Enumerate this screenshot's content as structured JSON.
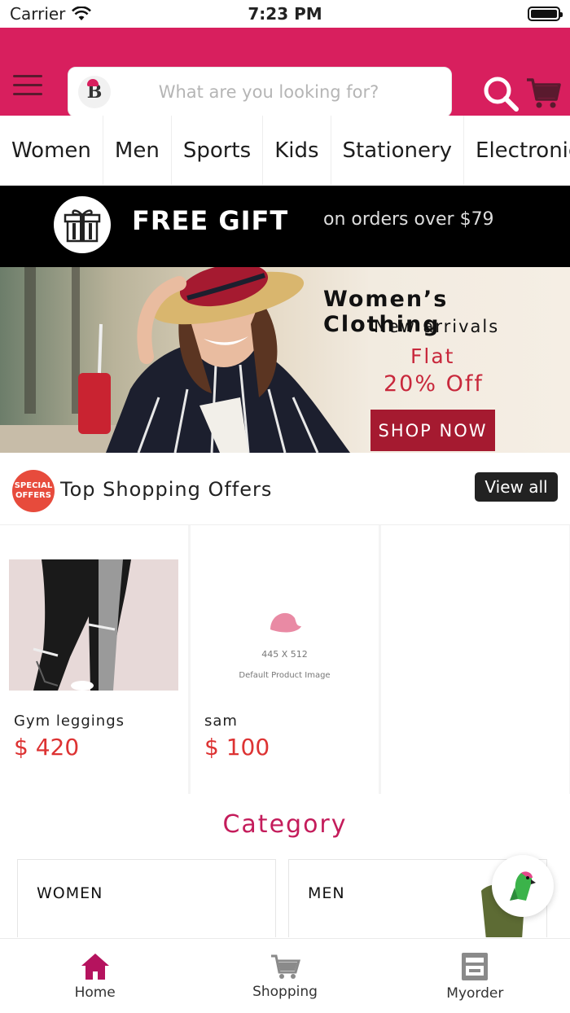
{
  "status_bar": {
    "carrier": "Carrier",
    "time": "7:23 PM"
  },
  "header": {
    "search_placeholder": "What are you looking for?",
    "logo_letter": "B",
    "brand_color": "#d81f5e"
  },
  "categories_strip": [
    "Women",
    "Men",
    "Sports",
    "Kids",
    "Stationery",
    "Electronics"
  ],
  "promo_bar": {
    "title": "FREE GIFT",
    "subtitle": "on orders over $79"
  },
  "banner": {
    "title": "Women’s Clothing",
    "subtitle": "New arrivals",
    "flat": "Flat",
    "discount": "20% Off",
    "cta": "SHOP NOW"
  },
  "offers": {
    "badge_line1": "SPECIAL",
    "badge_line2": "OFFERS",
    "title": "Top Shopping Offers",
    "view_all": "View all",
    "products": [
      {
        "name": "Gym leggings",
        "price": "$ 420"
      },
      {
        "name": "sam",
        "price": "$ 100",
        "image_dims": "445 X 512",
        "image_label": "Default Product Image"
      }
    ]
  },
  "category_section": {
    "title": "Category",
    "cards": [
      {
        "label": "WOMEN"
      },
      {
        "label": "MEN"
      }
    ]
  },
  "bottom_nav": [
    {
      "label": "Home",
      "icon": "home-icon",
      "active": true
    },
    {
      "label": "Shopping",
      "icon": "cart-icon",
      "active": false
    },
    {
      "label": "Myorder",
      "icon": "order-box-icon",
      "active": false
    }
  ]
}
